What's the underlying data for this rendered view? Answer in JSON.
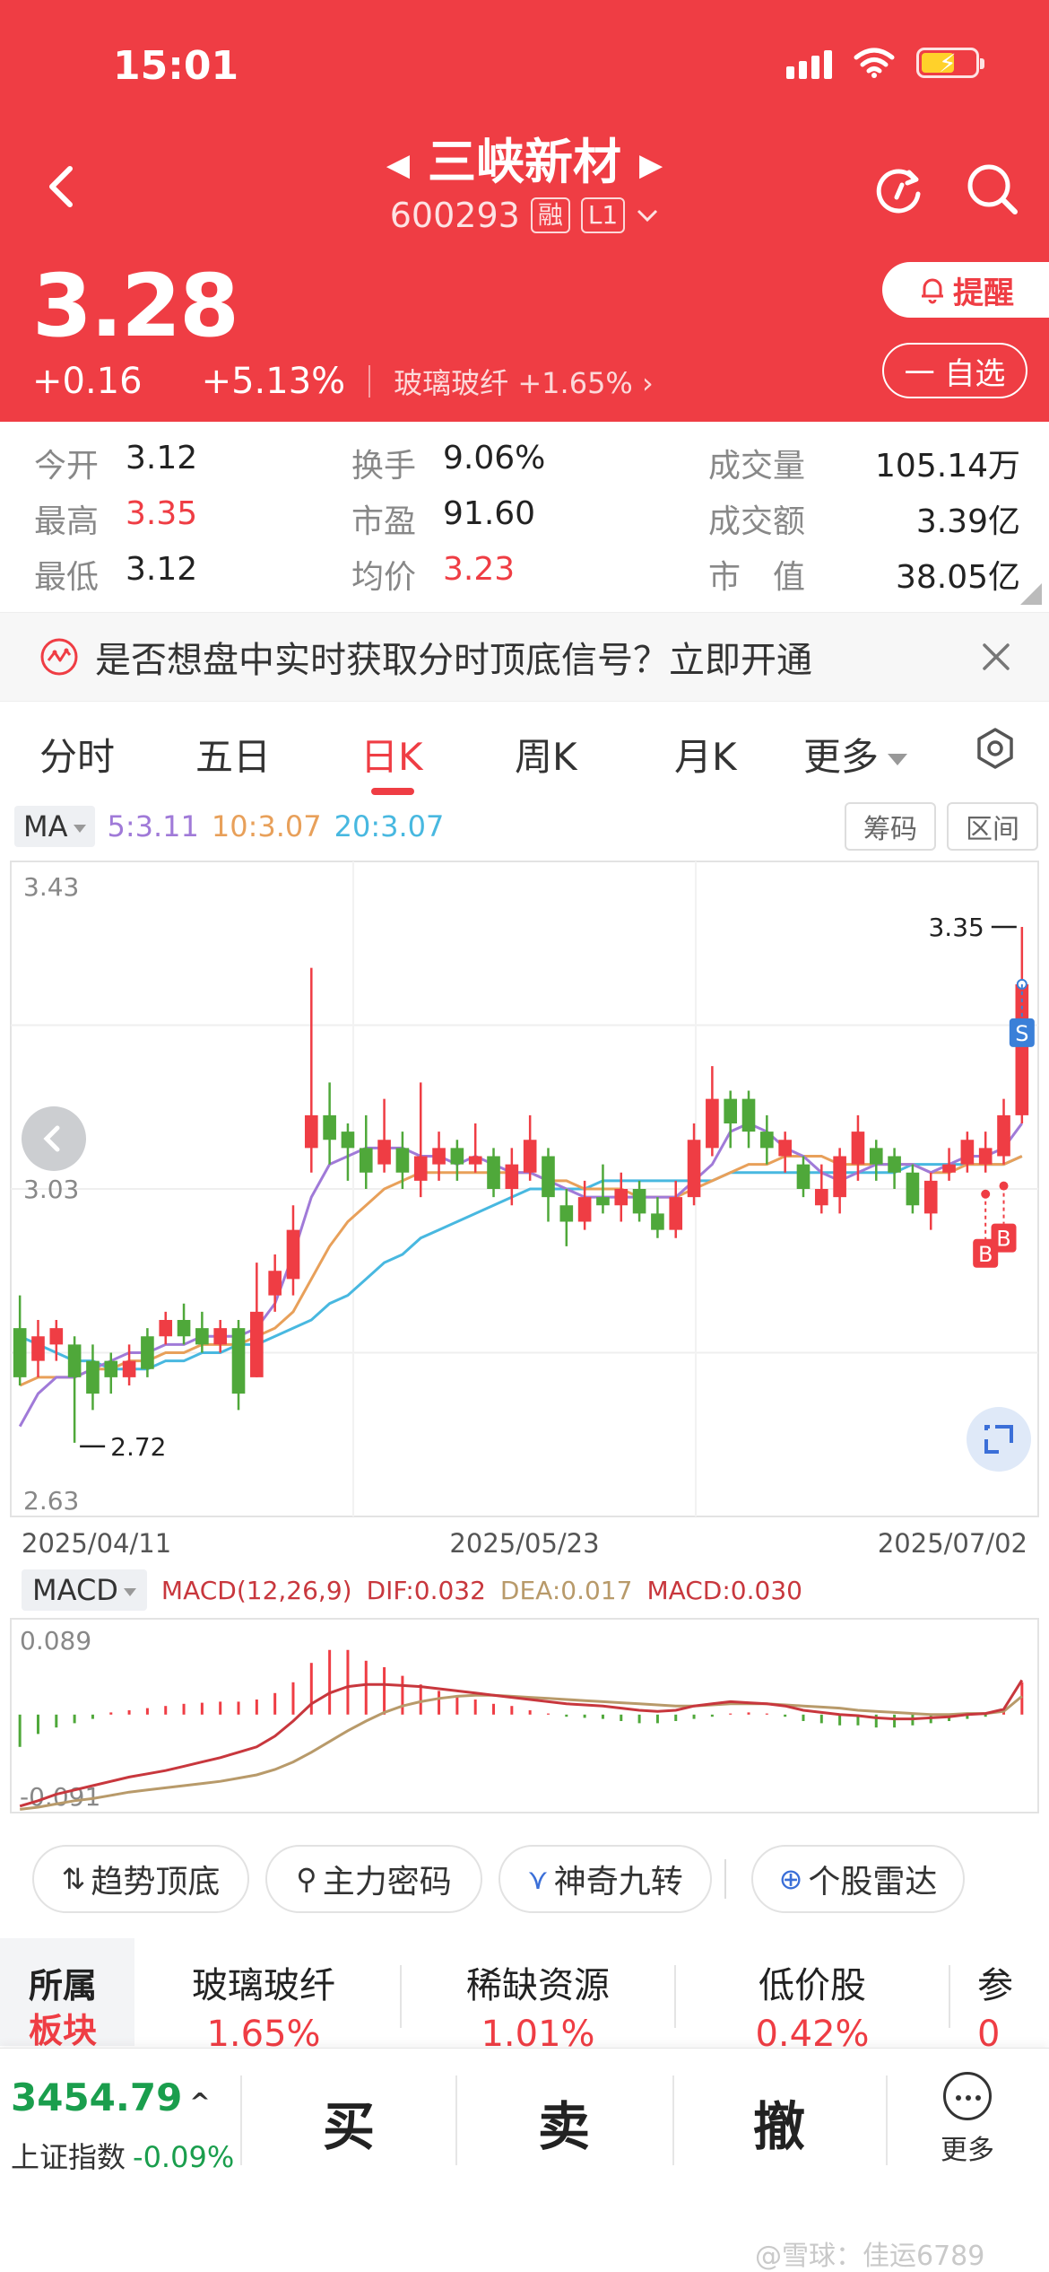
{
  "status": {
    "time": "15:01"
  },
  "header": {
    "stock_name": "三峡新材",
    "stock_code": "600293",
    "tag_margin": "融",
    "tag_level": "L1",
    "price": "3.28",
    "change": "+0.16",
    "change_pct": "+5.13%",
    "sector_name": "玻璃玻纤",
    "sector_pct": "+1.65%",
    "remind_label": "提醒",
    "watchlist_label": "一 自选"
  },
  "stats": {
    "open": {
      "label": "今开",
      "value": "3.12"
    },
    "high": {
      "label": "最高",
      "value": "3.35"
    },
    "low": {
      "label": "最低",
      "value": "3.12"
    },
    "turnover_rate": {
      "label": "换手",
      "value": "9.06%"
    },
    "pe": {
      "label": "市盈",
      "value": "91.60"
    },
    "avg_price": {
      "label": "均价",
      "value": "3.23"
    },
    "volume": {
      "label": "成交量",
      "value": "105.14万"
    },
    "amount": {
      "label": "成交额",
      "value": "3.39亿"
    },
    "mkt_cap": {
      "label": "市　值",
      "value": "38.05亿"
    }
  },
  "banner": {
    "text": "是否想盘中实时获取分时顶底信号？立即开通"
  },
  "tabs": [
    {
      "label": "分时"
    },
    {
      "label": "五日"
    },
    {
      "label": "日K",
      "active": true
    },
    {
      "label": "周K"
    },
    {
      "label": "月K"
    },
    {
      "label": "更多"
    }
  ],
  "ma_bar": {
    "dropdown": "MA",
    "ma5": "5:3.11",
    "ma10": "10:3.07",
    "ma20": "20:3.07",
    "chip_label": "筹码",
    "range_label": "区间"
  },
  "colors": {
    "up": "#ef3d44",
    "down": "#4fa83a",
    "ma5": "#a07ad8",
    "ma10": "#e8a05a",
    "ma20": "#48b8e0",
    "dif": "#c8373d",
    "dea": "#b89a6a"
  },
  "chart_data": {
    "type": "candlestick",
    "y_max_label": "3.43",
    "y_mid_label": "3.03",
    "y_min_label": "2.63",
    "ylim": [
      2.63,
      3.43
    ],
    "x_labels": [
      "2025/04/11",
      "2025/05/23",
      "2025/07/02"
    ],
    "high_marker": "3.35",
    "low_marker": "2.72",
    "signal_buy": "B",
    "signal_sell": "S",
    "candles": [
      {
        "o": 2.86,
        "c": 2.8,
        "h": 2.9,
        "l": 2.79
      },
      {
        "o": 2.82,
        "c": 2.85,
        "h": 2.87,
        "l": 2.8
      },
      {
        "o": 2.84,
        "c": 2.86,
        "h": 2.87,
        "l": 2.82
      },
      {
        "o": 2.84,
        "c": 2.8,
        "h": 2.85,
        "l": 2.72
      },
      {
        "o": 2.82,
        "c": 2.78,
        "h": 2.84,
        "l": 2.76
      },
      {
        "o": 2.82,
        "c": 2.8,
        "h": 2.83,
        "l": 2.78
      },
      {
        "o": 2.8,
        "c": 2.82,
        "h": 2.84,
        "l": 2.79
      },
      {
        "o": 2.85,
        "c": 2.81,
        "h": 2.86,
        "l": 2.8
      },
      {
        "o": 2.85,
        "c": 2.87,
        "h": 2.88,
        "l": 2.84
      },
      {
        "o": 2.87,
        "c": 2.85,
        "h": 2.89,
        "l": 2.84
      },
      {
        "o": 2.86,
        "c": 2.84,
        "h": 2.88,
        "l": 2.83
      },
      {
        "o": 2.84,
        "c": 2.86,
        "h": 2.87,
        "l": 2.83
      },
      {
        "o": 2.86,
        "c": 2.78,
        "h": 2.87,
        "l": 2.76
      },
      {
        "o": 2.8,
        "c": 2.88,
        "h": 2.94,
        "l": 2.8
      },
      {
        "o": 2.9,
        "c": 2.93,
        "h": 2.95,
        "l": 2.88
      },
      {
        "o": 2.92,
        "c": 2.98,
        "h": 3.01,
        "l": 2.9
      },
      {
        "o": 3.08,
        "c": 3.12,
        "h": 3.3,
        "l": 3.05
      },
      {
        "o": 3.12,
        "c": 3.09,
        "h": 3.16,
        "l": 3.06
      },
      {
        "o": 3.1,
        "c": 3.08,
        "h": 3.11,
        "l": 3.04
      },
      {
        "o": 3.08,
        "c": 3.05,
        "h": 3.12,
        "l": 3.03
      },
      {
        "o": 3.06,
        "c": 3.09,
        "h": 3.14,
        "l": 3.05
      },
      {
        "o": 3.08,
        "c": 3.05,
        "h": 3.1,
        "l": 3.03
      },
      {
        "o": 3.04,
        "c": 3.07,
        "h": 3.16,
        "l": 3.02
      },
      {
        "o": 3.06,
        "c": 3.08,
        "h": 3.1,
        "l": 3.04
      },
      {
        "o": 3.08,
        "c": 3.06,
        "h": 3.09,
        "l": 3.04
      },
      {
        "o": 3.06,
        "c": 3.07,
        "h": 3.11,
        "l": 3.05
      },
      {
        "o": 3.07,
        "c": 3.03,
        "h": 3.08,
        "l": 3.02
      },
      {
        "o": 3.03,
        "c": 3.06,
        "h": 3.08,
        "l": 3.01
      },
      {
        "o": 3.05,
        "c": 3.09,
        "h": 3.12,
        "l": 3.04
      },
      {
        "o": 3.07,
        "c": 3.02,
        "h": 3.08,
        "l": 2.99
      },
      {
        "o": 3.01,
        "c": 2.99,
        "h": 3.03,
        "l": 2.96
      },
      {
        "o": 2.99,
        "c": 3.02,
        "h": 3.04,
        "l": 2.98
      },
      {
        "o": 3.02,
        "c": 3.01,
        "h": 3.06,
        "l": 3.0
      },
      {
        "o": 3.01,
        "c": 3.03,
        "h": 3.05,
        "l": 2.99
      },
      {
        "o": 3.03,
        "c": 3.0,
        "h": 3.04,
        "l": 2.99
      },
      {
        "o": 3.0,
        "c": 2.98,
        "h": 3.02,
        "l": 2.97
      },
      {
        "o": 2.98,
        "c": 3.02,
        "h": 3.04,
        "l": 2.97
      },
      {
        "o": 3.02,
        "c": 3.09,
        "h": 3.11,
        "l": 3.01
      },
      {
        "o": 3.08,
        "c": 3.14,
        "h": 3.18,
        "l": 3.07
      },
      {
        "o": 3.14,
        "c": 3.11,
        "h": 3.15,
        "l": 3.08
      },
      {
        "o": 3.14,
        "c": 3.1,
        "h": 3.15,
        "l": 3.08
      },
      {
        "o": 3.1,
        "c": 3.08,
        "h": 3.12,
        "l": 3.06
      },
      {
        "o": 3.07,
        "c": 3.09,
        "h": 3.1,
        "l": 3.05
      },
      {
        "o": 3.06,
        "c": 3.03,
        "h": 3.07,
        "l": 3.02
      },
      {
        "o": 3.01,
        "c": 3.03,
        "h": 3.06,
        "l": 3.0
      },
      {
        "o": 3.02,
        "c": 3.07,
        "h": 3.08,
        "l": 3.0
      },
      {
        "o": 3.06,
        "c": 3.1,
        "h": 3.12,
        "l": 3.04
      },
      {
        "o": 3.08,
        "c": 3.06,
        "h": 3.09,
        "l": 3.04
      },
      {
        "o": 3.07,
        "c": 3.05,
        "h": 3.08,
        "l": 3.03
      },
      {
        "o": 3.05,
        "c": 3.01,
        "h": 3.06,
        "l": 3.0
      },
      {
        "o": 3.0,
        "c": 3.04,
        "h": 3.05,
        "l": 2.98
      },
      {
        "o": 3.05,
        "c": 3.06,
        "h": 3.08,
        "l": 3.04
      },
      {
        "o": 3.06,
        "c": 3.09,
        "h": 3.1,
        "l": 3.05
      },
      {
        "o": 3.06,
        "c": 3.08,
        "h": 3.1,
        "l": 3.05
      },
      {
        "o": 3.07,
        "c": 3.12,
        "h": 3.14,
        "l": 3.06
      },
      {
        "o": 3.12,
        "c": 3.28,
        "h": 3.35,
        "l": 3.11
      }
    ],
    "ma5": [
      2.74,
      2.78,
      2.8,
      2.8,
      2.81,
      2.82,
      2.83,
      2.83,
      2.84,
      2.84,
      2.85,
      2.85,
      2.85,
      2.86,
      2.89,
      2.95,
      3.02,
      3.06,
      3.07,
      3.08,
      3.08,
      3.08,
      3.07,
      3.07,
      3.06,
      3.07,
      3.06,
      3.05,
      3.05,
      3.04,
      3.03,
      3.02,
      3.02,
      3.02,
      3.02,
      3.02,
      3.02,
      3.04,
      3.06,
      3.1,
      3.11,
      3.1,
      3.08,
      3.07,
      3.05,
      3.04,
      3.05,
      3.06,
      3.06,
      3.06,
      3.05,
      3.06,
      3.07,
      3.07,
      3.08,
      3.11
    ],
    "ma10": [
      2.79,
      2.8,
      2.8,
      2.8,
      2.81,
      2.81,
      2.82,
      2.82,
      2.83,
      2.83,
      2.84,
      2.84,
      2.84,
      2.85,
      2.86,
      2.88,
      2.92,
      2.96,
      2.99,
      3.01,
      3.03,
      3.04,
      3.05,
      3.05,
      3.05,
      3.05,
      3.05,
      3.05,
      3.05,
      3.04,
      3.04,
      3.03,
      3.03,
      3.03,
      3.02,
      3.02,
      3.02,
      3.03,
      3.04,
      3.05,
      3.06,
      3.06,
      3.07,
      3.07,
      3.07,
      3.06,
      3.06,
      3.06,
      3.06,
      3.06,
      3.05,
      3.05,
      3.06,
      3.06,
      3.06,
      3.07
    ],
    "ma20": [
      2.85,
      2.84,
      2.83,
      2.82,
      2.82,
      2.81,
      2.81,
      2.81,
      2.82,
      2.82,
      2.83,
      2.83,
      2.84,
      2.84,
      2.85,
      2.86,
      2.87,
      2.89,
      2.9,
      2.92,
      2.94,
      2.95,
      2.97,
      2.98,
      2.99,
      3.0,
      3.01,
      3.02,
      3.03,
      3.03,
      3.03,
      3.03,
      3.04,
      3.04,
      3.04,
      3.04,
      3.04,
      3.04,
      3.04,
      3.05,
      3.05,
      3.05,
      3.05,
      3.05,
      3.05,
      3.05,
      3.05,
      3.05,
      3.05,
      3.06,
      3.06,
      3.06,
      3.06,
      3.06,
      3.06,
      3.07
    ],
    "buy_signals_at": [
      53,
      54
    ],
    "sell_signal_at": 55
  },
  "macd": {
    "dropdown": "MACD",
    "params": "MACD(12,26,9)",
    "dif": "DIF:0.032",
    "dea": "DEA:0.017",
    "macd": "MACD:0.030",
    "y_max_label": "0.089",
    "y_min_label": "-0.091",
    "ylim": [
      -0.091,
      0.089
    ],
    "hist": [
      -0.03,
      -0.018,
      -0.012,
      -0.008,
      -0.004,
      0.002,
      0.004,
      0.006,
      0.008,
      0.01,
      0.011,
      0.012,
      0.012,
      0.014,
      0.02,
      0.03,
      0.048,
      0.06,
      0.06,
      0.05,
      0.044,
      0.036,
      0.028,
      0.022,
      0.018,
      0.014,
      0.01,
      0.008,
      0.004,
      0.001,
      -0.002,
      -0.003,
      -0.004,
      -0.006,
      -0.008,
      -0.008,
      -0.006,
      -0.004,
      -0.002,
      0.001,
      0.002,
      0.001,
      -0.002,
      -0.006,
      -0.008,
      -0.01,
      -0.01,
      -0.012,
      -0.012,
      -0.01,
      -0.008,
      -0.006,
      -0.004,
      -0.002,
      0.003,
      0.03
    ],
    "dif_line": [
      -0.085,
      -0.08,
      -0.074,
      -0.07,
      -0.066,
      -0.062,
      -0.058,
      -0.055,
      -0.052,
      -0.048,
      -0.044,
      -0.04,
      -0.035,
      -0.03,
      -0.02,
      -0.006,
      0.01,
      0.02,
      0.026,
      0.028,
      0.028,
      0.027,
      0.026,
      0.024,
      0.022,
      0.02,
      0.018,
      0.016,
      0.014,
      0.012,
      0.01,
      0.009,
      0.008,
      0.006,
      0.004,
      0.003,
      0.004,
      0.008,
      0.01,
      0.012,
      0.011,
      0.01,
      0.008,
      0.004,
      0.002,
      0.0,
      -0.001,
      -0.003,
      -0.004,
      -0.004,
      -0.003,
      -0.002,
      0.0,
      0.001,
      0.005,
      0.032
    ],
    "dea_line": [
      -0.088,
      -0.086,
      -0.083,
      -0.08,
      -0.078,
      -0.075,
      -0.072,
      -0.07,
      -0.068,
      -0.066,
      -0.064,
      -0.062,
      -0.059,
      -0.056,
      -0.051,
      -0.044,
      -0.035,
      -0.025,
      -0.015,
      -0.006,
      0.002,
      0.008,
      0.012,
      0.015,
      0.017,
      0.018,
      0.018,
      0.017,
      0.016,
      0.015,
      0.014,
      0.013,
      0.012,
      0.011,
      0.01,
      0.009,
      0.008,
      0.008,
      0.009,
      0.01,
      0.01,
      0.01,
      0.009,
      0.008,
      0.007,
      0.006,
      0.004,
      0.003,
      0.002,
      0.001,
      0.0,
      0.0,
      0.001,
      0.001,
      0.003,
      0.017
    ]
  },
  "tools": [
    {
      "icon": "⇅",
      "label": "趋势顶底"
    },
    {
      "icon": "⚲",
      "label": "主力密码"
    },
    {
      "icon": "⋎",
      "label": "神奇九转"
    },
    {
      "icon": "⊕",
      "label": "个股雷达"
    }
  ],
  "sector_strip": {
    "title_1": "所属",
    "title_2": "板块",
    "items": [
      {
        "name": "玻璃玻纤",
        "pct": "1.65%"
      },
      {
        "name": "稀缺资源",
        "pct": "1.01%"
      },
      {
        "name": "低价股",
        "pct": "0.42%"
      },
      {
        "name": "参",
        "pct": "0"
      }
    ]
  },
  "tradebar": {
    "index_value": "3454.79",
    "index_name": "上证指数",
    "index_change": "-0.09%",
    "buy": "买",
    "sell": "卖",
    "cancel": "撤",
    "more": "更多",
    "watermark": "@雪球：佳运6789"
  }
}
